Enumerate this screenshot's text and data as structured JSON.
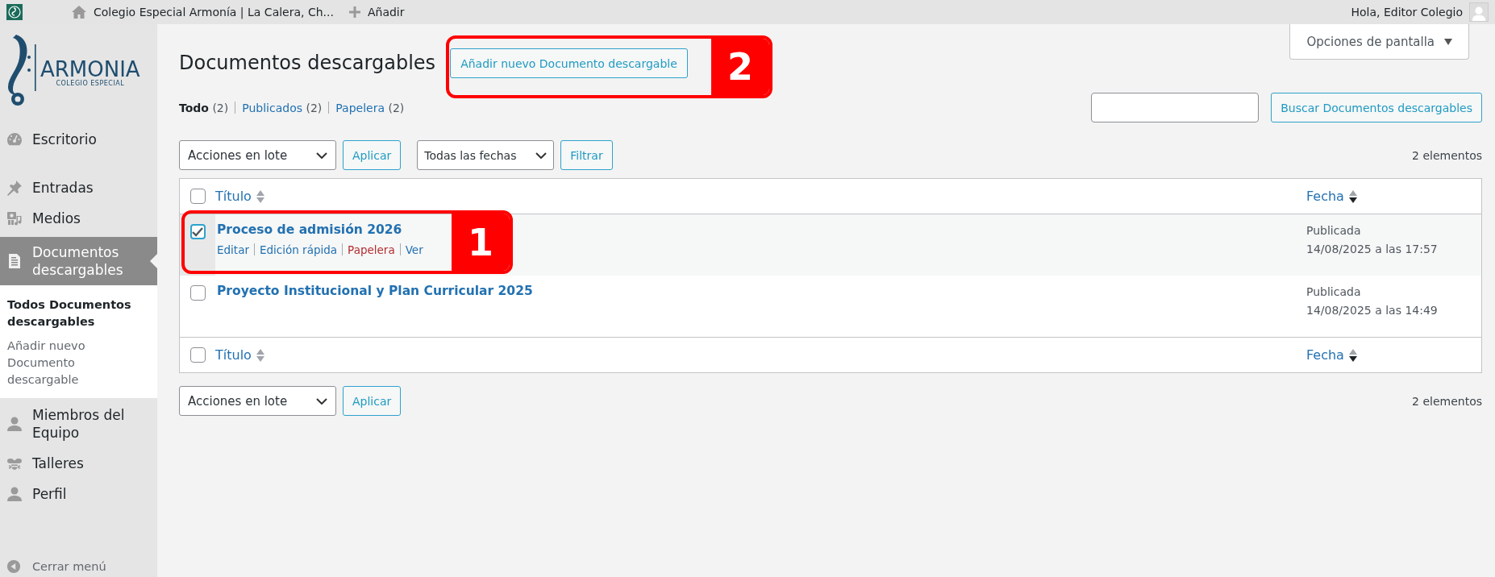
{
  "top_bar": {
    "site_name": "Colegio Especial Armonía | La Calera, Ch...",
    "new_label": "Añadir",
    "greeting": "Hola, Editor Colegio"
  },
  "sidebar": {
    "logo": {
      "name": "ARMONIA",
      "tagline": "COLEGIO ESPECIAL"
    },
    "items": [
      {
        "label": "Escritorio",
        "selected": false
      },
      {
        "label": "Entradas",
        "selected": false
      },
      {
        "label": "Medios",
        "selected": false
      },
      {
        "label": "Documentos descargables",
        "selected": true,
        "children": [
          {
            "label": "Todos Documentos descargables",
            "selected": true
          },
          {
            "label": "Añadir nuevo Documento descargable",
            "selected": false
          }
        ]
      },
      {
        "label": "Miembros del Equipo",
        "selected": false
      },
      {
        "label": "Talleres",
        "selected": false
      },
      {
        "label": "Perfil",
        "selected": false
      }
    ],
    "collapse_label": "Cerrar menú"
  },
  "screen_options": "Opciones de pantalla",
  "page": {
    "title": "Documentos descargables",
    "add_button": "Añadir nuevo Documento descargable",
    "views": [
      {
        "label": "Todo",
        "count": "(2)",
        "selected": true
      },
      {
        "label": "Publicados",
        "count": "(2)",
        "selected": false
      },
      {
        "label": "Papelera",
        "count": "(2)",
        "selected": false
      }
    ],
    "search_button": "Buscar Documentos descargables",
    "top_nav": {
      "bulk_select": "Acciones en lote",
      "apply": "Aplicar",
      "date_select": "Todas las fechas",
      "filter": "Filtrar",
      "count": "2 elementos"
    },
    "bottom_nav": {
      "bulk_select": "Acciones en lote",
      "apply": "Aplicar",
      "count": "2 elementos"
    }
  },
  "table": {
    "select_all_checked": false,
    "columns": [
      {
        "label": "Título",
        "sorted": false
      },
      {
        "label": "Fecha",
        "sorted": true
      }
    ],
    "rows": [
      {
        "title": "Proceso de admisión 2026",
        "checked": true,
        "hover": true,
        "status": "Publicada",
        "date": "14/08/2025 a las 17:57",
        "actions": [
          {
            "label": "Editar",
            "kind": "link"
          },
          {
            "label": "Edición rápida",
            "kind": "link"
          },
          {
            "label": "Papelera",
            "kind": "delete"
          },
          {
            "label": "Ver",
            "kind": "link"
          }
        ]
      },
      {
        "title": "Proyecto Institucional y Plan Curricular 2025",
        "checked": false,
        "hover": false,
        "status": "Publicada",
        "date": "14/08/2025 a las 14:49"
      }
    ],
    "footer_select_all_checked": false,
    "footer_columns": [
      {
        "label": "Título",
        "sorted": false
      },
      {
        "label": "Fecha",
        "sorted": true
      }
    ]
  },
  "annotations": [
    {
      "number": "1"
    },
    {
      "number": "2"
    }
  ]
}
